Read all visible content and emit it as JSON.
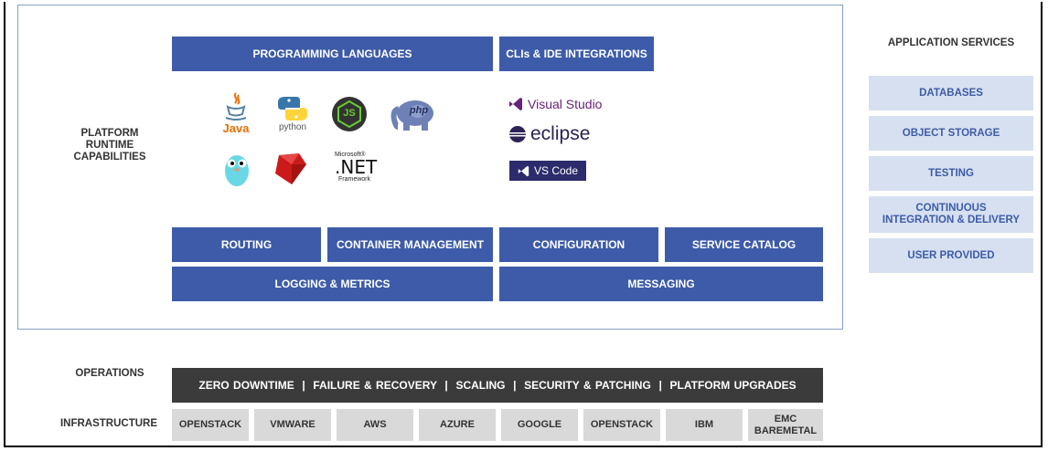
{
  "labels": {
    "platform": [
      "PLATFORM",
      "RUNTIME",
      "CAPABILITIES"
    ],
    "application_services": "APPLICATION SERVICES",
    "operations": "OPERATIONS",
    "infrastructure": "INFRASTRUCTURE"
  },
  "headers": {
    "programming_languages": "PROGRAMMING LANGUAGES",
    "clis_ide": "CLIs & IDE INTEGRATIONS"
  },
  "languages": {
    "java": "Java",
    "python": "python",
    "nodejs": "JS",
    "php": "php",
    "net_top": "Microsoft®",
    "net_main": ".NET",
    "net_bottom": "Framework"
  },
  "ides": {
    "visual_studio": "Visual Studio",
    "eclipse": "eclipse",
    "vscode": "VS Code"
  },
  "capabilities": {
    "routing": "ROUTING",
    "container_management": "CONTAINER MANAGEMENT",
    "configuration": "CONFIGURATION",
    "service_catalog": "SERVICE CATALOG",
    "logging_metrics": "LOGGING & METRICS",
    "messaging": "MESSAGING"
  },
  "services": [
    [
      "DATABASES"
    ],
    [
      "OBJECT STORAGE"
    ],
    [
      "TESTING"
    ],
    [
      "CONTINUOUS",
      "INTEGRATION & DELIVERY"
    ],
    [
      "USER PROVIDED"
    ]
  ],
  "operations_bar": "ZERO DOWNTIME  |  FAILURE & RECOVERY  |  SCALING  |  SECURITY & PATCHING  |  PLATFORM UPGRADES",
  "infrastructure": [
    [
      "OPENSTACK"
    ],
    [
      "VMWARE"
    ],
    [
      "AWS"
    ],
    [
      "AZURE"
    ],
    [
      "GOOGLE"
    ],
    [
      "OPENSTACK"
    ],
    [
      "IBM"
    ],
    [
      "EMC",
      "BAREMETAL"
    ]
  ],
  "colors": {
    "primary_blue": "#3d5ba8",
    "service_bg": "#d6e0f1",
    "ops_bg": "#3b3b3b",
    "infra_bg": "#d9d9d9"
  }
}
